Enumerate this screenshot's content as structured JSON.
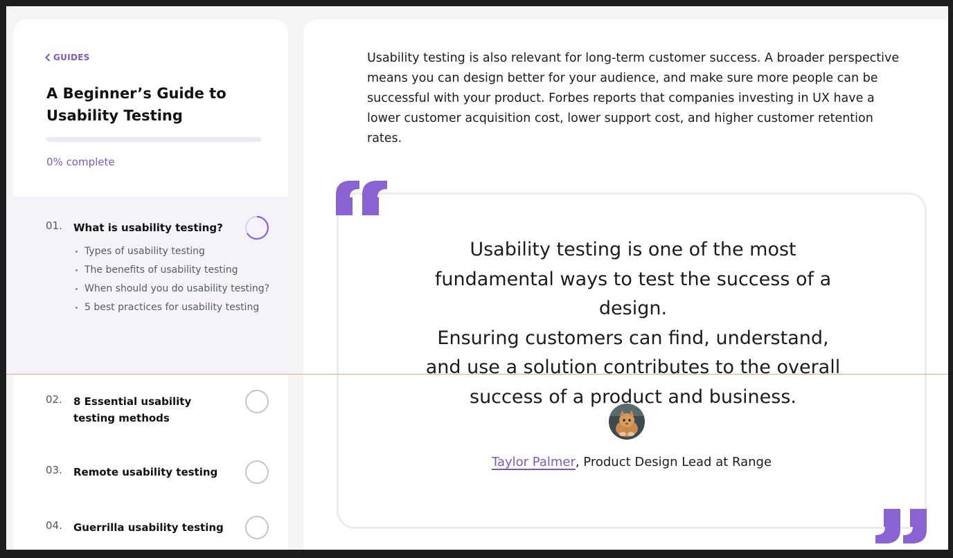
{
  "sidebar": {
    "back_label": "GUIDES",
    "guide_title": "A Beginner’s Guide to Usability Testing",
    "progress_percent": 0,
    "progress_text": "0% complete",
    "chapters": [
      {
        "number": "01.",
        "title": "What is usability testing?",
        "active": true,
        "subitems": [
          "Types of usability testing",
          "The benefits of usability testing",
          "When should you do usability testing?",
          "5 best practices for usability testing"
        ]
      },
      {
        "number": "02.",
        "title": "8 Essential usability testing methods",
        "active": false
      },
      {
        "number": "03.",
        "title": "Remote usability testing",
        "active": false
      },
      {
        "number": "04.",
        "title": "Guerrilla usability testing",
        "active": false
      }
    ]
  },
  "main": {
    "intro_paragraph": "Usability testing is also relevant for long-term customer success. A broader perspective means you can design better for your audience, and make sure more people can be successful with your product. Forbes reports that companies investing in UX have a lower customer acquisition cost, lower support cost, and higher customer retention rates.",
    "quote": {
      "line1": "Usability testing is one of the most fundamental ways to test the success of a design.",
      "line2": "Ensuring customers can find, understand, and use a solution contributes to the overall success of a product and business.",
      "author_name": "Taylor Palmer",
      "author_role": ", Product Design Lead at Range"
    }
  },
  "colors": {
    "accent": "#8a63d2",
    "active_chapter_bg": "#f5f2fa",
    "page_bg": "#f4f4f4"
  }
}
